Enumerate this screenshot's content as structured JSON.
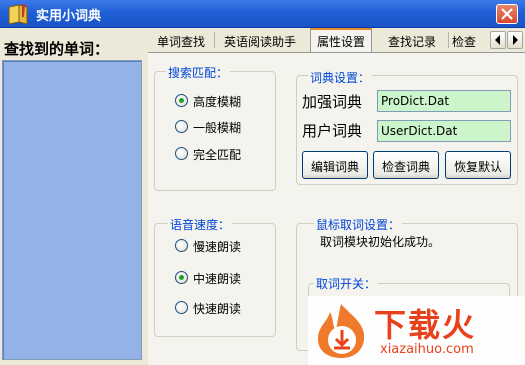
{
  "window": {
    "title": "实用小词典",
    "icon": "dictionary-book-icon",
    "close_icon": "close-icon"
  },
  "left_panel": {
    "heading": "查找到的单词：",
    "list_items": []
  },
  "tabs": [
    {
      "label": "单词查找",
      "active": false
    },
    {
      "label": "英语阅读助手",
      "active": false
    },
    {
      "label": "属性设置",
      "active": true
    },
    {
      "label": "查找记录",
      "active": false
    },
    {
      "label": "检查",
      "active": false
    }
  ],
  "tab_scroll": {
    "left_icon": "arrow-left-icon",
    "right_icon": "arrow-right-icon"
  },
  "search_match": {
    "title": "搜索匹配：",
    "options": [
      {
        "label": "高度模糊",
        "selected": true
      },
      {
        "label": "一般模糊",
        "selected": false
      },
      {
        "label": "完全匹配",
        "selected": false
      }
    ]
  },
  "dictionary_settings": {
    "title": "词典设置：",
    "enhanced_label": "加强词典",
    "enhanced_value": "ProDict.Dat",
    "user_label": "用户词典",
    "user_value": "UserDict.Dat",
    "buttons": {
      "edit": "编辑词典",
      "check": "检查词典",
      "restore": "恢复默认"
    }
  },
  "speech_speed": {
    "title": "语音速度：",
    "options": [
      {
        "label": "慢速朗读",
        "selected": false
      },
      {
        "label": "中速朗读",
        "selected": true
      },
      {
        "label": "快速朗读",
        "selected": false
      }
    ]
  },
  "mouse_pick": {
    "title": "鼠标取词设置：",
    "status": "取词模块初始化成功。",
    "switch_title": "取词开关："
  },
  "watermark": {
    "brand": "下载火",
    "url": "xiazaihuo.com"
  },
  "colors": {
    "title_bar": "#1f5fd6",
    "word_list_bg": "#94b1e8",
    "field_bg": "#ccf5cc",
    "group_title": "#0046d5",
    "radio_selected": "#21a121",
    "active_tab_accent": "#e68b2c",
    "watermark": "#e8411b"
  }
}
